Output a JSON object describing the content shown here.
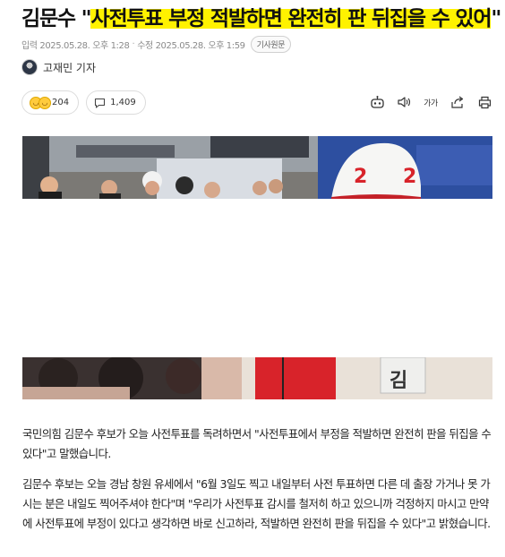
{
  "article": {
    "headline_prefix": "김문수 \"",
    "headline_highlight": "사전투표 부정 적발하면 완전히 판 뒤집을 수 있어",
    "headline_suffix": "\"",
    "published": "입력 2025.05.28. 오후 1:28",
    "modified": "수정 2025.05.28. 오후 1:59",
    "original_button": "기사원문",
    "reporter": "고재민 기자",
    "reaction_count": "204",
    "comment_count": "1,409",
    "font_size_label": "가가",
    "paragraphs": [
      "국민의힘 김문수 후보가 오늘 사전투표를 독려하면서 \"사전투표에서 부정을 적발하면 완전히 판을 뒤집을 수 있다\"고 말했습니다.",
      "김문수 후보는 오늘 경남 창원 유세에서 \"6월 3일도 찍고 내일부터 사전 투표하면 다른 데 출장 가거나 못 가시는 분은 내일도 찍어주셔야 한다\"며 \"우리가 사전투표 감시를 철저히 하고 있으니까 걱정하지 마시고 만약에 사전투표에 부정이 있다고 생각하면 바로 신고하라, 적발하면 완전히 판을 뒤집을 수 있다\"고 밝혔습니다."
    ]
  },
  "photo": {
    "helmet_number": "2",
    "vest_text": "김",
    "sign_text": "2"
  },
  "colors": {
    "highlight": "#fff200",
    "party_red": "#d8232a",
    "text": "#222222"
  },
  "icons": [
    "reaction-emoji-icon",
    "comment-icon",
    "audio-summary-icon",
    "speaker-icon",
    "font-size-icon",
    "share-icon",
    "print-icon"
  ]
}
